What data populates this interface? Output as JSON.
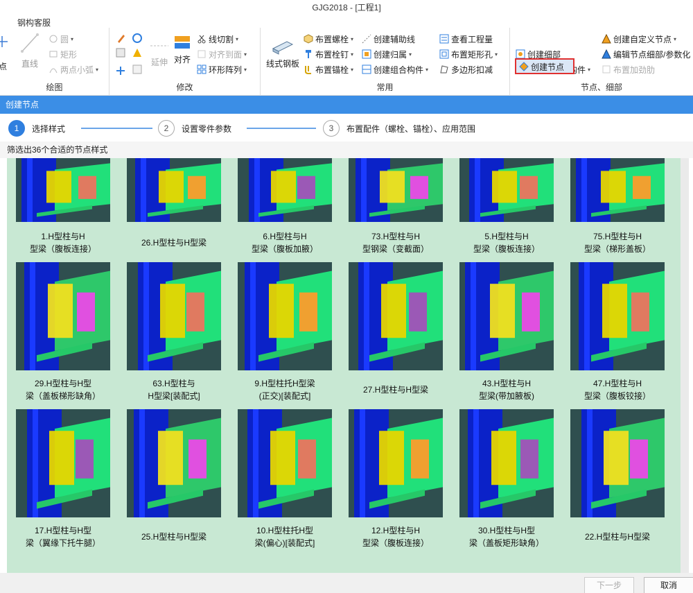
{
  "window": {
    "title": "GJG2018 - [工程1]"
  },
  "menu": {
    "tab": "钢构客服"
  },
  "ribbon": {
    "draw": {
      "group_label": "绘图",
      "point": "点",
      "line": "直线",
      "circle": "圆",
      "rect": "矩形",
      "two_point_arc": "两点小弧"
    },
    "modify": {
      "group_label": "修改",
      "extend": "延伸",
      "align": "对齐",
      "line_cut": "线切割",
      "align_to_face": "对齐到面",
      "ring_array": "环形阵列"
    },
    "common": {
      "group_label": "常用",
      "line_steel_plate": "线式钢板",
      "place_bolt": "布置螺栓",
      "place_stud": "布置栓钉",
      "place_anchor": "布置锚栓",
      "create_aux_line": "创建辅助线",
      "create_group": "创建归属",
      "create_assembly": "创建组合构件",
      "check_quantity": "查看工程量",
      "rect_hole": "布置矩形孔",
      "polygon_cut": "多边形扣减"
    },
    "nodes": {
      "group_label": "节点、细部",
      "create_node": "创建节点",
      "create_detail": "创建细部",
      "create_param": "创建参数化构件",
      "create_custom_node": "创建自定义节点",
      "edit_node_detail": "编辑节点细部/参数化",
      "place_stiffener": "布置加劲肋"
    }
  },
  "dialog": {
    "title": "创建节点",
    "steps": [
      {
        "num": "1",
        "label": "选择样式"
      },
      {
        "num": "2",
        "label": "设置零件参数"
      },
      {
        "num": "3",
        "label": "布置配件（螺栓、锚栓）、应用范围"
      }
    ],
    "filter_text": "筛选出36个合适的节点样式",
    "nodes": [
      {
        "line1": "1.H型柱与H",
        "line2": "型梁（腹板连接）"
      },
      {
        "line1": "26.H型柱与H型梁",
        "line2": ""
      },
      {
        "line1": "6.H型柱与H",
        "line2": "型梁（腹板加腋）"
      },
      {
        "line1": "73.H型柱与H",
        "line2": "型钢梁（变截面）"
      },
      {
        "line1": "5.H型柱与H",
        "line2": "型梁（腹板连接）"
      },
      {
        "line1": "75.H型柱与H",
        "line2": "型梁（梯形盖板）"
      },
      {
        "line1": "29.H型柱与H型",
        "line2": "梁（盖板梯形缺角）"
      },
      {
        "line1": "63.H型柱与",
        "line2": "H型梁[装配式]"
      },
      {
        "line1": "9.H型柱托H型梁",
        "line2": "(正交)[装配式]"
      },
      {
        "line1": "27.H型柱与H型梁",
        "line2": ""
      },
      {
        "line1": "43.H型柱与H",
        "line2": "型梁(带加腋板)"
      },
      {
        "line1": "47.H型柱与H",
        "line2": "型梁（腹板铰接）"
      },
      {
        "line1": "17.H型柱与H型",
        "line2": "梁（翼缘下托牛腿）"
      },
      {
        "line1": "25.H型柱与H型梁",
        "line2": ""
      },
      {
        "line1": "10.H型柱托H型",
        "line2": "梁(偏心)[装配式]"
      },
      {
        "line1": "12.H型柱与H",
        "line2": "型梁（腹板连接）"
      },
      {
        "line1": "30.H型柱与H型",
        "line2": "梁（盖板矩形缺角）"
      },
      {
        "line1": "22.H型柱与H型梁",
        "line2": ""
      }
    ],
    "next_button": "下一步",
    "cancel_button": "取消"
  },
  "colors": {
    "accent": "#3b8ee6",
    "gallery_bg": "#c8e8d3",
    "highlight_border": "#e03030"
  }
}
